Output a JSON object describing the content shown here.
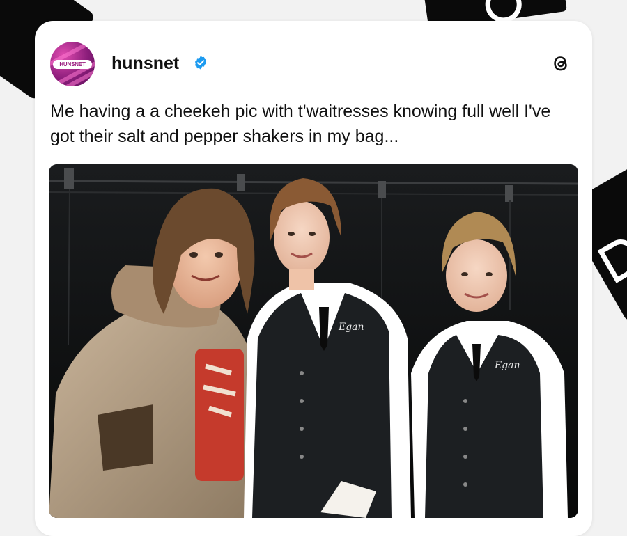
{
  "post": {
    "username": "hunsnet",
    "avatar_text": "HUNSNET",
    "caption": "Me having a a cheekeh pic with t'waitresses knowing full well I've got their salt and pepper shakers in my bag...",
    "verified_icon": "verified-badge-icon",
    "app_icon": "threads-icon",
    "vest_logo_text": "Egan"
  },
  "colors": {
    "card_bg": "#ffffff",
    "verified_blue": "#1d9bf0",
    "avatar_pink": "#b1268f"
  }
}
